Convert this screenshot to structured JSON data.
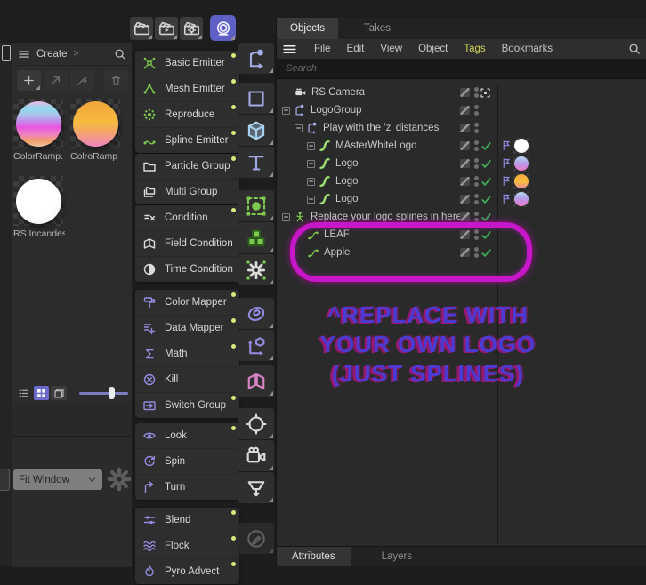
{
  "colors": {
    "accent_purple": "#5f60c4",
    "enabled_dot": "#d9e87a",
    "check_green": "#3fae5a",
    "tags_highlight": "#cdd05b",
    "annotation_magenta": "#c617c9",
    "annotation_purple": "#4b3bd2"
  },
  "topbar": {
    "buttons": [
      {
        "icon": "clapperboard-icon"
      },
      {
        "icon": "clapperboard-play-icon"
      },
      {
        "icon": "clapperboard-gear-icon"
      }
    ],
    "render_button": {
      "icon": "render-ring-icon"
    }
  },
  "create_panel": {
    "menu_icon": "hamburger-icon",
    "title": "Create",
    "arrow": ">",
    "search_icon": "search-icon",
    "toolbar": [
      {
        "icon": "plus-icon",
        "enabled": true
      },
      {
        "icon": "arrow-up-right-icon",
        "enabled": false
      },
      {
        "icon": "eyedropper-icon",
        "enabled": false
      },
      {
        "icon": "trash-icon",
        "enabled": false
      }
    ],
    "materials": [
      {
        "label": "ColorRamp.",
        "swatch": "rainbow"
      },
      {
        "label": "ColroRamp",
        "swatch": "orange-pink"
      },
      {
        "label": "RS Incandes",
        "swatch": "white"
      }
    ],
    "view_controls": {
      "buttons": [
        {
          "icon": "list-view-icon",
          "active": false
        },
        {
          "icon": "grid-view-icon",
          "active": true
        },
        {
          "icon": "layer-view-icon",
          "active": false
        }
      ],
      "slider_percent": 68
    },
    "fit_window": {
      "value": "Fit Window",
      "chevron_icon": "chevron-down-icon",
      "gear_icon": "gear-icon"
    }
  },
  "menu": {
    "groups": [
      {
        "items": [
          {
            "label": "Basic Emitter",
            "icon": "basic-emitter-icon",
            "color": "green",
            "dot": true
          },
          {
            "label": "Mesh Emitter",
            "icon": "mesh-emitter-icon",
            "color": "green",
            "dot": true
          },
          {
            "label": "Reproduce",
            "icon": "reproduce-icon",
            "color": "green",
            "dot": true
          },
          {
            "label": "Spline Emitter",
            "icon": "spline-emitter-icon",
            "color": "green",
            "dot": true
          }
        ]
      },
      {
        "items": [
          {
            "label": "Particle Group",
            "icon": "folder-icon",
            "color": "white",
            "dot": true
          },
          {
            "label": "Multi Group",
            "icon": "folders-icon",
            "color": "white",
            "dot": false
          }
        ]
      },
      {
        "items": [
          {
            "label": "Condition",
            "icon": "condition-icon",
            "color": "white",
            "dot": true
          },
          {
            "label": "Field Condition",
            "icon": "field-condition-icon",
            "color": "white",
            "dot": false
          },
          {
            "label": "Time Condition",
            "icon": "time-condition-icon",
            "color": "white",
            "dot": false
          }
        ]
      },
      {
        "items": [
          {
            "label": "Color Mapper",
            "icon": "color-mapper-icon",
            "color": "purple",
            "dot": true
          },
          {
            "label": "Data Mapper",
            "icon": "data-mapper-icon",
            "color": "purple",
            "dot": true
          },
          {
            "label": "Math",
            "icon": "math-icon",
            "color": "purple",
            "dot": true
          },
          {
            "label": "Kill",
            "icon": "kill-icon",
            "color": "purple",
            "dot": false
          },
          {
            "label": "Switch Group",
            "icon": "switch-group-icon",
            "color": "purple",
            "dot": true
          }
        ]
      },
      {
        "items": [
          {
            "label": "Look",
            "icon": "look-icon",
            "color": "purple",
            "dot": true
          },
          {
            "label": "Spin",
            "icon": "spin-icon",
            "color": "purple",
            "dot": false
          },
          {
            "label": "Turn",
            "icon": "turn-icon",
            "color": "purple",
            "dot": false
          }
        ]
      },
      {
        "items": [
          {
            "label": "Blend",
            "icon": "blend-icon",
            "color": "purple",
            "dot": true
          },
          {
            "label": "Flock",
            "icon": "flock-icon",
            "color": "purple",
            "dot": true
          },
          {
            "label": "Pyro Advect",
            "icon": "pyro-advect-icon",
            "color": "purple",
            "dot": true
          }
        ]
      }
    ]
  },
  "side_toolbar": {
    "groups": [
      [
        {
          "icon": "move-tool-icon",
          "color": "lav"
        }
      ],
      [
        {
          "icon": "plane-tool-icon",
          "color": "lav"
        },
        {
          "icon": "cube-tool-icon",
          "color": "blue"
        },
        {
          "icon": "text-tool-icon",
          "color": "lav"
        }
      ],
      [
        {
          "icon": "emitter-tool-icon",
          "color": "green"
        },
        {
          "icon": "cluster-tool-icon",
          "color": "green"
        },
        {
          "icon": "gear-tool-icon",
          "color": "white"
        }
      ],
      [
        {
          "icon": "sweep-tool-icon",
          "color": "purple"
        },
        {
          "icon": "instance-tool-icon",
          "color": "purple"
        }
      ],
      [
        {
          "icon": "field-tool-icon",
          "color": "pink"
        }
      ],
      [
        {
          "icon": "sky-tool-icon",
          "color": "white"
        },
        {
          "icon": "camera-tool-icon",
          "color": "white"
        },
        {
          "icon": "stage-tool-icon",
          "color": "white"
        }
      ],
      [
        {
          "icon": "locked-pen-tool-icon",
          "color": "gray",
          "disabled": true
        }
      ]
    ]
  },
  "objects_panel": {
    "tabs": [
      {
        "label": "Objects",
        "active": true
      },
      {
        "label": "Takes",
        "active": false
      }
    ],
    "menu_icon": "hamburger-icon",
    "menu_items": [
      {
        "label": "File"
      },
      {
        "label": "Edit"
      },
      {
        "label": "View"
      },
      {
        "label": "Object"
      },
      {
        "label": "Tags",
        "highlight": true
      },
      {
        "label": "Bookmarks"
      }
    ],
    "search_icon": "search-icon",
    "search_placeholder": "Search",
    "tree": [
      {
        "label": "RS Camera",
        "icon": "camera-icon",
        "depth": 1,
        "expander": null,
        "edit": true,
        "dots": true,
        "target": true
      },
      {
        "label": "LogoGroup",
        "icon": "null-icon",
        "depth": 0,
        "expander": "minus",
        "edit": true,
        "dots": true
      },
      {
        "label": "Play with the 'z'  distances",
        "icon": "null-icon",
        "depth": 1,
        "expander": "minus",
        "edit": true,
        "dots": true
      },
      {
        "label": "MAsterWhiteLogo",
        "icon": "sweep-object-icon",
        "depth": 2,
        "expander": "plus",
        "edit": true,
        "dots": true,
        "check": true,
        "flag": true,
        "material": "white"
      },
      {
        "label": "Logo",
        "icon": "sweep-object-icon",
        "depth": 2,
        "expander": "plus",
        "edit": true,
        "dots": true,
        "check": true,
        "flag": true,
        "material": "cool"
      },
      {
        "label": "Logo",
        "icon": "sweep-object-icon",
        "depth": 2,
        "expander": "plus",
        "edit": true,
        "dots": true,
        "check": true,
        "flag": true,
        "material": "warm"
      },
      {
        "label": "Logo",
        "icon": "sweep-object-icon",
        "depth": 2,
        "expander": "plus",
        "edit": true,
        "dots": true,
        "check": true,
        "flag": true,
        "material": "cool"
      },
      {
        "label": "Replace your logo splines in here",
        "icon": "emitter-figure-icon",
        "depth": 0,
        "expander": "minus",
        "edit": true,
        "dots": true,
        "check": true
      },
      {
        "label": "LEAF",
        "icon": "spline-icon",
        "depth": 2,
        "expander": null,
        "edit": true,
        "dots": true,
        "check": true
      },
      {
        "label": "Apple",
        "icon": "spline-icon",
        "depth": 2,
        "expander": null,
        "edit": true,
        "dots": true,
        "check": true
      }
    ],
    "annotation": {
      "circle_color": "#c617c9",
      "text_lines": [
        "^REPLACE WITH",
        "YOUR OWN LOGO",
        "(JUST SPLINES)"
      ],
      "text_color": "#4b3bd2",
      "shadow_color": "#a8157f"
    },
    "bottom_tabs": [
      {
        "label": "Attributes",
        "active": true
      },
      {
        "label": "Layers",
        "active": false
      }
    ]
  }
}
